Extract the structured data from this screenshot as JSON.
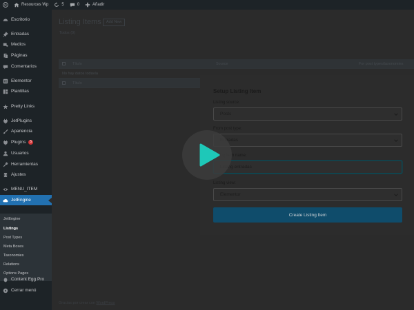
{
  "adminbar": {
    "site_name": "Resources Wp",
    "updates_count": "5",
    "comments_count": "0",
    "new_label": "Añadir"
  },
  "sidebar": {
    "items": [
      {
        "label": "Escritorio",
        "icon": "dashboard-icon"
      },
      {
        "label": "Entradas",
        "icon": "pin-icon"
      },
      {
        "label": "Medios",
        "icon": "media-icon"
      },
      {
        "label": "Páginas",
        "icon": "pages-icon"
      },
      {
        "label": "Comentarios",
        "icon": "comment-icon"
      },
      {
        "label": "Elementor",
        "icon": "elementor-icon"
      },
      {
        "label": "Plantillas",
        "icon": "templates-icon"
      },
      {
        "label": "Pretty Links",
        "icon": "star-icon"
      },
      {
        "label": "JetPlugins",
        "icon": "plug-icon"
      },
      {
        "label": "Apariencia",
        "icon": "brush-icon"
      },
      {
        "label": "Plugins",
        "icon": "plugin-icon",
        "badge": "5"
      },
      {
        "label": "Usuarios",
        "icon": "user-icon"
      },
      {
        "label": "Herramientas",
        "icon": "wrench-icon"
      },
      {
        "label": "Ajustes",
        "icon": "settings-icon"
      },
      {
        "label": "MENU_ITEM",
        "icon": "eye-icon"
      },
      {
        "label": "JetEngine",
        "icon": "cloud-icon"
      }
    ],
    "submenu": [
      {
        "label": "JetEngine"
      },
      {
        "label": "Listings"
      },
      {
        "label": "Post Types"
      },
      {
        "label": "Meta Boxes"
      },
      {
        "label": "Taxonomies"
      },
      {
        "label": "Relations"
      },
      {
        "label": "Options Pages"
      }
    ],
    "bottom": [
      {
        "label": "Content Egg Pro",
        "icon": "egg-icon"
      },
      {
        "label": "Cerrar menú",
        "icon": "collapse-icon"
      }
    ]
  },
  "main": {
    "title": "Listing Items",
    "add_new": "Add New",
    "filter_all": "Todos (0)",
    "table": {
      "col_title": "Título",
      "col_source": "Source",
      "col_context": "For post types/taxonomies",
      "empty": "No hay datos todavía"
    },
    "footer": "Gracias por crear con ",
    "footer_link": "WordPress"
  },
  "modal": {
    "title": "Setup Listing Item",
    "source_label": "Listing source:",
    "source_value": "Posts",
    "post_type_label": "From post type:",
    "post_type_value": "Entradas",
    "name_label": "Listing item name:",
    "name_value": "Listing entradas",
    "view_label": "Listing view:",
    "view_value": "Elementor",
    "submit": "Create Listing Item"
  },
  "colors": {
    "sidebar_bg": "#1d2327",
    "active_menu": "#2271b1",
    "button": "#0f4c6b",
    "play_triangle": "#1ec8b8"
  }
}
